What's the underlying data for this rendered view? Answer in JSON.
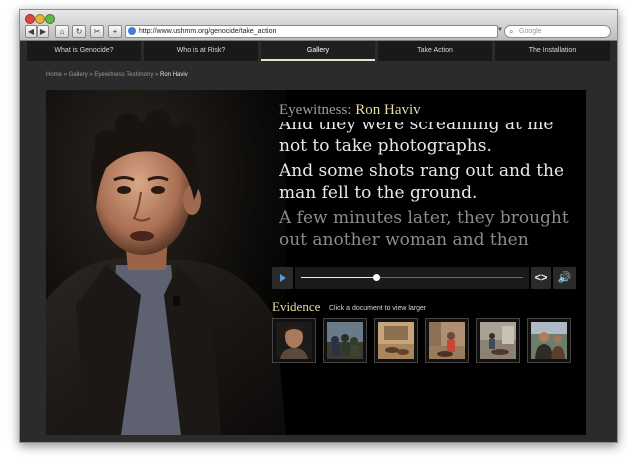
{
  "browser": {
    "url": "http://www.ushmm.org/genocide/take_action",
    "search_placeholder": "Google",
    "buttons": {
      "back": "◀",
      "forward": "▶",
      "home": "⌂",
      "reload": "↻",
      "cut": "✂",
      "add": "+"
    }
  },
  "nav": {
    "tabs": [
      {
        "label": "What is Genocide?"
      },
      {
        "label": "Who is at Risk?"
      },
      {
        "label": "Gallery"
      },
      {
        "label": "Take Action"
      },
      {
        "label": "The Installation"
      }
    ],
    "active": "Gallery"
  },
  "breadcrumb": {
    "items": [
      "Home",
      "Gallery",
      "Eyewitness Testimony"
    ],
    "separator": "»",
    "current": "Ron Haviv"
  },
  "eyewitness": {
    "prefix": "Eyewitness:",
    "name": "Ron Haviv"
  },
  "transcript": {
    "lines": [
      "And they were screaming at me",
      "not to take photographs.",
      "And some shots rang out and the man fell to the ground.",
      "A few minutes later, they brought out another woman and then"
    ]
  },
  "player": {
    "progress": 0.34,
    "buffered": 0.33,
    "prev_label": "<",
    "next_label": ">",
    "volume_label": "🔊"
  },
  "evidence": {
    "title": "Evidence",
    "hint": "Click a document to view larger",
    "thumbnail_count": 6
  },
  "colors": {
    "accent_gold": "#e7dba0",
    "play_blue": "#4f9fe0",
    "page_bg": "#2b2b2b"
  }
}
